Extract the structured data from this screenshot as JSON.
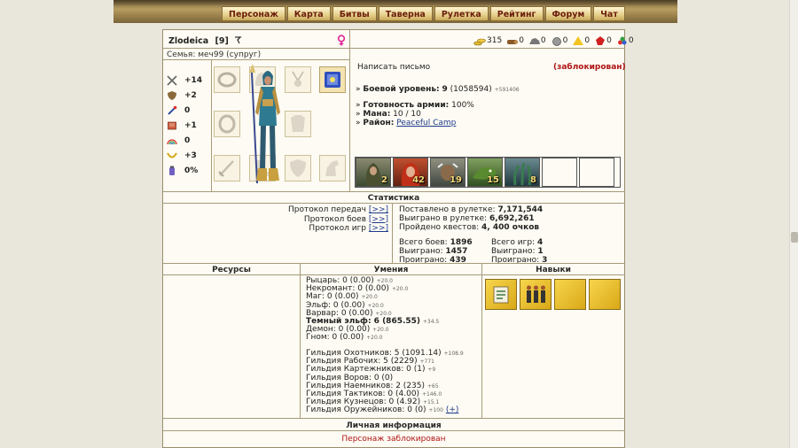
{
  "nav": [
    "Персонаж",
    "Карта",
    "Битвы",
    "Таверна",
    "Рулетка",
    "Рейтинг",
    "Форум",
    "Чат"
  ],
  "player": {
    "name": "Zlodeica",
    "level": "[9]",
    "family": "Семья: меч99 (супруг)"
  },
  "resources": {
    "gold": "315",
    "r1": "0",
    "r2": "0",
    "r3": "0",
    "r4": "0",
    "r5": "0",
    "r6": "0"
  },
  "stats": [
    "+14",
    "+2",
    "0",
    "+1",
    "0",
    "+3",
    "0%"
  ],
  "info": {
    "write_letter": "Написать письмо",
    "blocked": "(заблокирован)",
    "combat_label": "Боевой уровень:",
    "combat_level": "9",
    "combat_exp": "(1058594)",
    "combat_exp_small": "+591406",
    "army_label": "Готовность армии:",
    "army_value": "100%",
    "mana_label": "Мана:",
    "mana_value": "10 / 10",
    "district_label": "Район:",
    "district_value": "Peaceful Camp"
  },
  "units": [
    "2",
    "42",
    "19",
    "15",
    "8"
  ],
  "statistics": {
    "title": "Статистика",
    "protocols": [
      {
        "label": "Протокол передач",
        "link": "[>>]"
      },
      {
        "label": "Протокол боев",
        "link": "[>>]"
      },
      {
        "label": "Протокол игр",
        "link": "[>>]"
      }
    ],
    "roulette_placed_label": "Поставлено в рулетке:",
    "roulette_placed": "7,171,544",
    "roulette_won_label": "Выиграно в рулетке:",
    "roulette_won": "6,692,261",
    "quests_label": "Пройдено квестов:",
    "quests": "4, 400 очков",
    "battles_total_label": "Всего боев:",
    "battles_total": "1896",
    "battles_won_label": "Выиграно:",
    "battles_won": "1457",
    "battles_lost_label": "Проиграно:",
    "battles_lost": "439",
    "games_total_label": "Всего игр:",
    "games_total": "4",
    "games_won_label": "Выиграно:",
    "games_won": "1",
    "games_lost_label": "Проиграно:",
    "games_lost": "3"
  },
  "sections": {
    "resources": "Ресурсы",
    "abilities": "Умения",
    "skills": "Навыки",
    "personal": "Личная информация",
    "blocked_note": "Персонаж заблокирован"
  },
  "abilities": [
    {
      "text": "Рыцарь: 0 (0.00)",
      "small": "+20.0",
      "bold": false
    },
    {
      "text": "Некромант: 0 (0.00)",
      "small": "+20.0",
      "bold": false
    },
    {
      "text": "Маг: 0 (0.00)",
      "small": "+20.0",
      "bold": false
    },
    {
      "text": "Эльф: 0 (0.00)",
      "small": "+20.0",
      "bold": false
    },
    {
      "text": "Варвар: 0 (0.00)",
      "small": "+20.0",
      "bold": false
    },
    {
      "text": "Темный эльф: 6 (865.55)",
      "small": "+34.5",
      "bold": true
    },
    {
      "text": "Демон: 0 (0.00)",
      "small": "+20.0",
      "bold": false
    },
    {
      "text": "Гном: 0 (0.00)",
      "small": "+20.0",
      "bold": false
    }
  ],
  "guilds": [
    {
      "text": "Гильдия Охотников: 5 (1091.14)",
      "small": "+108.9"
    },
    {
      "text": "Гильдия Рабочих: 5 (2229)",
      "small": "+771"
    },
    {
      "text": "Гильдия Картежников: 0 (1)",
      "small": "+9"
    },
    {
      "text": "Гильдия Воров: 0 (0)",
      "small": ""
    },
    {
      "text": "Гильдия Наемников: 2 (235)",
      "small": "+65"
    },
    {
      "text": "Гильдия Тактиков: 0 (4.00)",
      "small": "+146.0"
    },
    {
      "text": "Гильдия Кузнецов: 0 (4.92)",
      "small": "+15.1"
    },
    {
      "text": "Гильдия Оружейников: 0 (0)",
      "small": "+100"
    }
  ],
  "guild_plus": "(+)",
  "colors": {
    "accent": "#8a6d36",
    "blocked": "#b01414",
    "link": "#1d3a8a"
  }
}
